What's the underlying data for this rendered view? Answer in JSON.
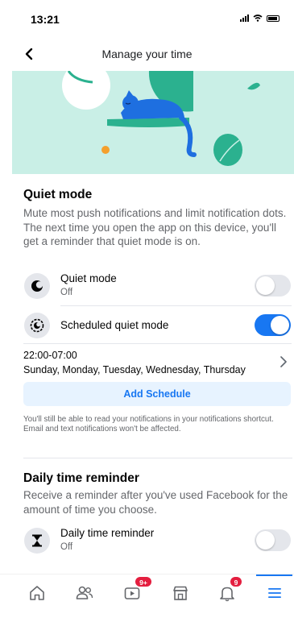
{
  "status_bar": {
    "time": "13:21"
  },
  "header": {
    "title": "Manage your time"
  },
  "quiet_mode": {
    "title": "Quiet mode",
    "description": "Mute most push notifications and limit notification dots. The next time you open the app on this device, you'll get a reminder that quiet mode is on.",
    "toggle_row": {
      "label": "Quiet mode",
      "status": "Off",
      "enabled": false
    },
    "scheduled_row": {
      "label": "Scheduled quiet mode",
      "enabled": true
    },
    "schedule": {
      "time_range": "22:00-07:00",
      "days": "Sunday, Monday, Tuesday, Wednesday, Thursday"
    },
    "add_schedule_label": "Add Schedule",
    "footnote": "You'll still be able to read your notifications in your notifications shortcut. Email and text notifications won't be affected."
  },
  "daily_reminder": {
    "title": "Daily time reminder",
    "description": "Receive a reminder after you've used Facebook for the amount of time you choose.",
    "row": {
      "label": "Daily time reminder",
      "status": "Off",
      "enabled": false
    }
  },
  "bottom_nav": {
    "video_badge": "9+",
    "notifications_badge": "9",
    "active_tab": "menu"
  },
  "colors": {
    "accent": "#1877f2",
    "banner_bg": "#c9efe6",
    "badge": "#e41e3f"
  }
}
